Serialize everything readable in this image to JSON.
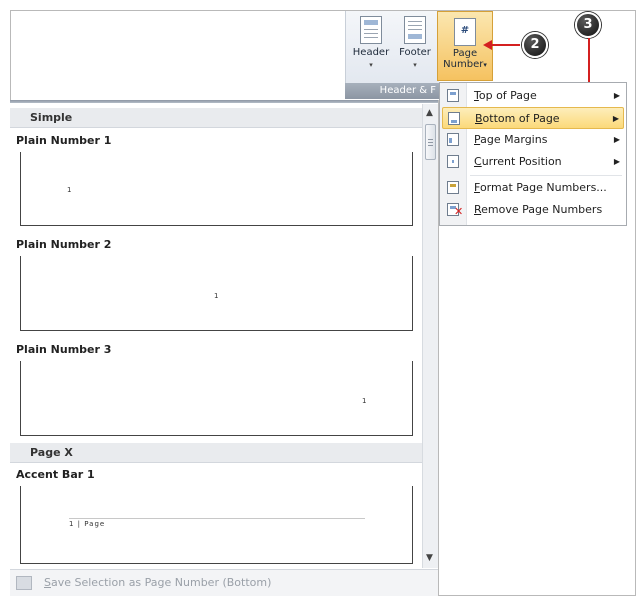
{
  "ribbon": {
    "header_label": "Header",
    "footer_label": "Footer",
    "page_number_line1": "Page",
    "page_number_line2": "Number",
    "page_number_caret": "▾",
    "group_label": "Header & F",
    "page_number_glyph": "#"
  },
  "callouts": {
    "step2": "2",
    "step3": "3"
  },
  "gallery": {
    "sections": [
      {
        "title": "Simple",
        "items": [
          {
            "title": "Plain Number 1",
            "preview_number": "1"
          },
          {
            "title": "Plain Number 2",
            "preview_number": "1"
          },
          {
            "title": "Plain Number 3",
            "preview_number": "1"
          }
        ]
      },
      {
        "title": "Page X",
        "items": [
          {
            "title": "Accent Bar 1",
            "preview_text": "1 | Page"
          }
        ]
      }
    ],
    "footer_label": "Save Selection as Page Number (Bottom)",
    "footer_hotkey": "S"
  },
  "menu": {
    "items": [
      {
        "label": "Top of Page",
        "hotkey": "T",
        "rest": "op of Page",
        "has_submenu": true,
        "icon": "page-top-icon"
      },
      {
        "label": "Bottom of Page",
        "hotkey": "B",
        "rest": "ottom of Page",
        "has_submenu": true,
        "icon": "page-bottom-icon",
        "highlighted": true
      },
      {
        "label": "Page Margins",
        "hotkey": "P",
        "rest": "age Margins",
        "has_submenu": true,
        "icon": "page-margins-icon"
      },
      {
        "label": "Current Position",
        "hotkey": "C",
        "rest": "urrent Position",
        "has_submenu": true,
        "icon": "current-position-icon"
      },
      {
        "label": "Format Page Numbers...",
        "hotkey": "F",
        "rest": "ormat Page Numbers...",
        "has_submenu": false,
        "icon": "format-page-numbers-icon"
      },
      {
        "label": "Remove Page Numbers",
        "hotkey": "R",
        "rest": "emove Page Numbers",
        "has_submenu": false,
        "icon": "remove-page-numbers-icon"
      }
    ],
    "submenu_arrow": "▶"
  },
  "colors": {
    "accent_highlight": "#fbd97a",
    "callout_arrow": "#d42020",
    "ribbon_group_label": "#8c96a3"
  }
}
